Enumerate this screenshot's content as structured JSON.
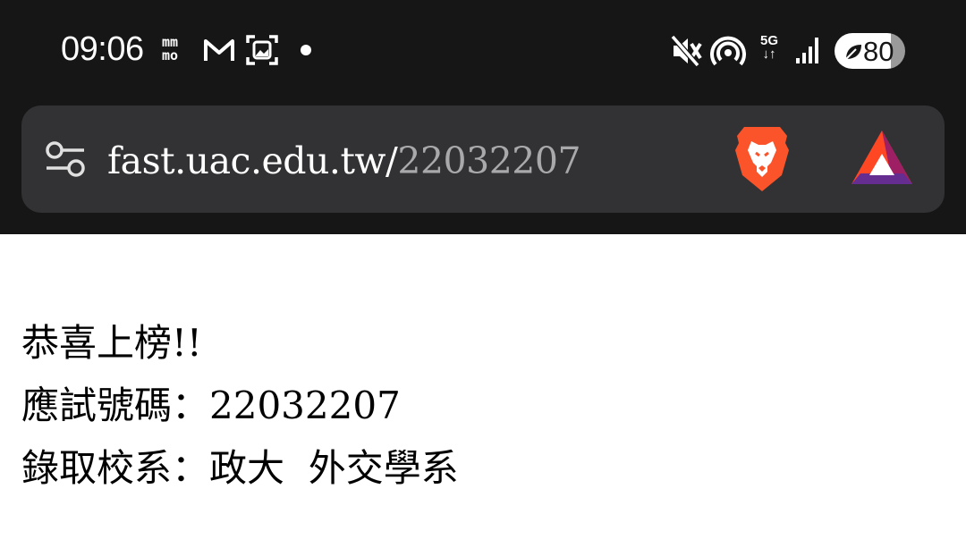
{
  "status_bar": {
    "time": "09:06",
    "icons": [
      "mm-app-icon",
      "gmail-icon",
      "screenshot-icon",
      "notification-dot-icon",
      "vibrate-off-icon",
      "hotspot-icon",
      "5g-network-icon",
      "signal-icon",
      "battery-saver-icon"
    ],
    "network_label": "5G",
    "battery_level": "80",
    "battery_fraction": 0.8
  },
  "browser": {
    "url_host": "fast.uac.edu.tw/",
    "url_path": "22032207",
    "brand_colors": {
      "lion": "#fb542b",
      "bat": "#662d91"
    }
  },
  "result": {
    "congrats": "恭喜上榜!!",
    "exam_number_label": "應試號碼：",
    "exam_number": "22032207",
    "admission_label": "錄取校系：",
    "admission_school": "政大",
    "admission_department": "外交學系"
  }
}
